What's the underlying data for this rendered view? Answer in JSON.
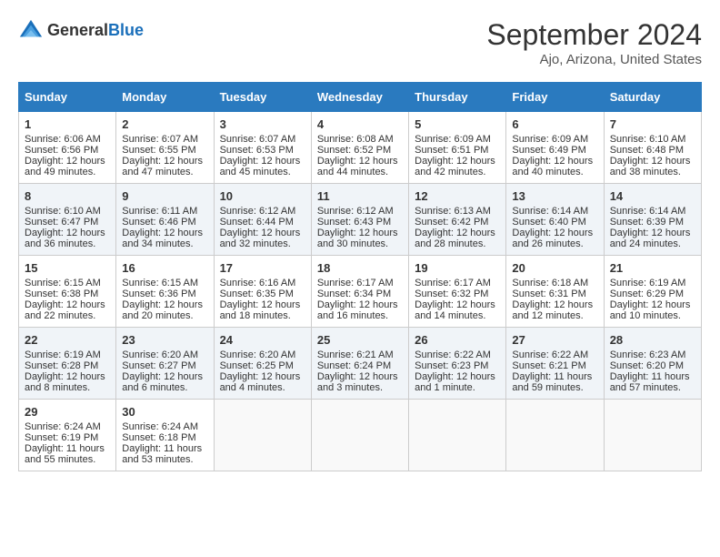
{
  "header": {
    "logo_general": "General",
    "logo_blue": "Blue",
    "month_title": "September 2024",
    "location": "Ajo, Arizona, United States"
  },
  "days_of_week": [
    "Sunday",
    "Monday",
    "Tuesday",
    "Wednesday",
    "Thursday",
    "Friday",
    "Saturday"
  ],
  "weeks": [
    [
      {
        "day": 1,
        "lines": [
          "Sunrise: 6:06 AM",
          "Sunset: 6:56 PM",
          "Daylight: 12 hours",
          "and 49 minutes."
        ]
      },
      {
        "day": 2,
        "lines": [
          "Sunrise: 6:07 AM",
          "Sunset: 6:55 PM",
          "Daylight: 12 hours",
          "and 47 minutes."
        ]
      },
      {
        "day": 3,
        "lines": [
          "Sunrise: 6:07 AM",
          "Sunset: 6:53 PM",
          "Daylight: 12 hours",
          "and 45 minutes."
        ]
      },
      {
        "day": 4,
        "lines": [
          "Sunrise: 6:08 AM",
          "Sunset: 6:52 PM",
          "Daylight: 12 hours",
          "and 44 minutes."
        ]
      },
      {
        "day": 5,
        "lines": [
          "Sunrise: 6:09 AM",
          "Sunset: 6:51 PM",
          "Daylight: 12 hours",
          "and 42 minutes."
        ]
      },
      {
        "day": 6,
        "lines": [
          "Sunrise: 6:09 AM",
          "Sunset: 6:49 PM",
          "Daylight: 12 hours",
          "and 40 minutes."
        ]
      },
      {
        "day": 7,
        "lines": [
          "Sunrise: 6:10 AM",
          "Sunset: 6:48 PM",
          "Daylight: 12 hours",
          "and 38 minutes."
        ]
      }
    ],
    [
      {
        "day": 8,
        "lines": [
          "Sunrise: 6:10 AM",
          "Sunset: 6:47 PM",
          "Daylight: 12 hours",
          "and 36 minutes."
        ]
      },
      {
        "day": 9,
        "lines": [
          "Sunrise: 6:11 AM",
          "Sunset: 6:46 PM",
          "Daylight: 12 hours",
          "and 34 minutes."
        ]
      },
      {
        "day": 10,
        "lines": [
          "Sunrise: 6:12 AM",
          "Sunset: 6:44 PM",
          "Daylight: 12 hours",
          "and 32 minutes."
        ]
      },
      {
        "day": 11,
        "lines": [
          "Sunrise: 6:12 AM",
          "Sunset: 6:43 PM",
          "Daylight: 12 hours",
          "and 30 minutes."
        ]
      },
      {
        "day": 12,
        "lines": [
          "Sunrise: 6:13 AM",
          "Sunset: 6:42 PM",
          "Daylight: 12 hours",
          "and 28 minutes."
        ]
      },
      {
        "day": 13,
        "lines": [
          "Sunrise: 6:14 AM",
          "Sunset: 6:40 PM",
          "Daylight: 12 hours",
          "and 26 minutes."
        ]
      },
      {
        "day": 14,
        "lines": [
          "Sunrise: 6:14 AM",
          "Sunset: 6:39 PM",
          "Daylight: 12 hours",
          "and 24 minutes."
        ]
      }
    ],
    [
      {
        "day": 15,
        "lines": [
          "Sunrise: 6:15 AM",
          "Sunset: 6:38 PM",
          "Daylight: 12 hours",
          "and 22 minutes."
        ]
      },
      {
        "day": 16,
        "lines": [
          "Sunrise: 6:15 AM",
          "Sunset: 6:36 PM",
          "Daylight: 12 hours",
          "and 20 minutes."
        ]
      },
      {
        "day": 17,
        "lines": [
          "Sunrise: 6:16 AM",
          "Sunset: 6:35 PM",
          "Daylight: 12 hours",
          "and 18 minutes."
        ]
      },
      {
        "day": 18,
        "lines": [
          "Sunrise: 6:17 AM",
          "Sunset: 6:34 PM",
          "Daylight: 12 hours",
          "and 16 minutes."
        ]
      },
      {
        "day": 19,
        "lines": [
          "Sunrise: 6:17 AM",
          "Sunset: 6:32 PM",
          "Daylight: 12 hours",
          "and 14 minutes."
        ]
      },
      {
        "day": 20,
        "lines": [
          "Sunrise: 6:18 AM",
          "Sunset: 6:31 PM",
          "Daylight: 12 hours",
          "and 12 minutes."
        ]
      },
      {
        "day": 21,
        "lines": [
          "Sunrise: 6:19 AM",
          "Sunset: 6:29 PM",
          "Daylight: 12 hours",
          "and 10 minutes."
        ]
      }
    ],
    [
      {
        "day": 22,
        "lines": [
          "Sunrise: 6:19 AM",
          "Sunset: 6:28 PM",
          "Daylight: 12 hours",
          "and 8 minutes."
        ]
      },
      {
        "day": 23,
        "lines": [
          "Sunrise: 6:20 AM",
          "Sunset: 6:27 PM",
          "Daylight: 12 hours",
          "and 6 minutes."
        ]
      },
      {
        "day": 24,
        "lines": [
          "Sunrise: 6:20 AM",
          "Sunset: 6:25 PM",
          "Daylight: 12 hours",
          "and 4 minutes."
        ]
      },
      {
        "day": 25,
        "lines": [
          "Sunrise: 6:21 AM",
          "Sunset: 6:24 PM",
          "Daylight: 12 hours",
          "and 3 minutes."
        ]
      },
      {
        "day": 26,
        "lines": [
          "Sunrise: 6:22 AM",
          "Sunset: 6:23 PM",
          "Daylight: 12 hours",
          "and 1 minute."
        ]
      },
      {
        "day": 27,
        "lines": [
          "Sunrise: 6:22 AM",
          "Sunset: 6:21 PM",
          "Daylight: 11 hours",
          "and 59 minutes."
        ]
      },
      {
        "day": 28,
        "lines": [
          "Sunrise: 6:23 AM",
          "Sunset: 6:20 PM",
          "Daylight: 11 hours",
          "and 57 minutes."
        ]
      }
    ],
    [
      {
        "day": 29,
        "lines": [
          "Sunrise: 6:24 AM",
          "Sunset: 6:19 PM",
          "Daylight: 11 hours",
          "and 55 minutes."
        ]
      },
      {
        "day": 30,
        "lines": [
          "Sunrise: 6:24 AM",
          "Sunset: 6:18 PM",
          "Daylight: 11 hours",
          "and 53 minutes."
        ]
      },
      null,
      null,
      null,
      null,
      null
    ]
  ]
}
